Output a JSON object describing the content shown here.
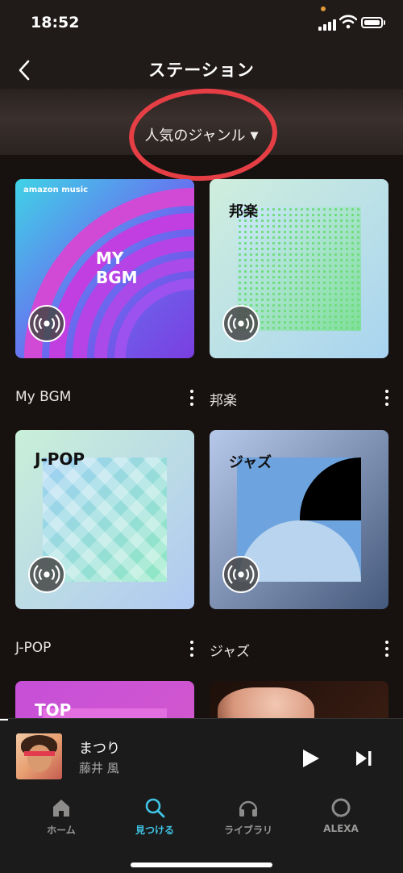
{
  "status_bar": {
    "time": "18:52"
  },
  "header": {
    "title": "ステーション",
    "genre_label": "人気のジャンル",
    "genre_caret": "▼"
  },
  "stations": [
    {
      "label": "My BGM",
      "tile_text_line1": "MY",
      "tile_text_line2": "BGM",
      "brand": "amazon music"
    },
    {
      "label": "邦楽",
      "tile_text": "邦楽"
    },
    {
      "label": "J-POP",
      "tile_text": "J-POP"
    },
    {
      "label": "ジャズ",
      "tile_text": "ジャズ"
    },
    {
      "label": "",
      "tile_text": "TOP"
    },
    {
      "label": "",
      "tile_text": ""
    }
  ],
  "now_playing": {
    "title": "まつり",
    "artist": "藤井 風",
    "progress": 0.02
  },
  "nav": {
    "home": "ホーム",
    "find": "見つける",
    "library": "ライブラリ",
    "alexa": "ALEXA"
  },
  "colors": {
    "accent": "#3fc5e6",
    "annotation_circle": "#e53f45"
  },
  "icons": {
    "back": "chevron-left-icon",
    "radio": "radio-broadcast-icon",
    "more": "more-vertical-icon",
    "play": "play-icon",
    "next": "skip-next-icon",
    "home": "home-icon",
    "find": "search-icon",
    "library": "headphones-icon",
    "alexa": "alexa-ring-icon"
  }
}
